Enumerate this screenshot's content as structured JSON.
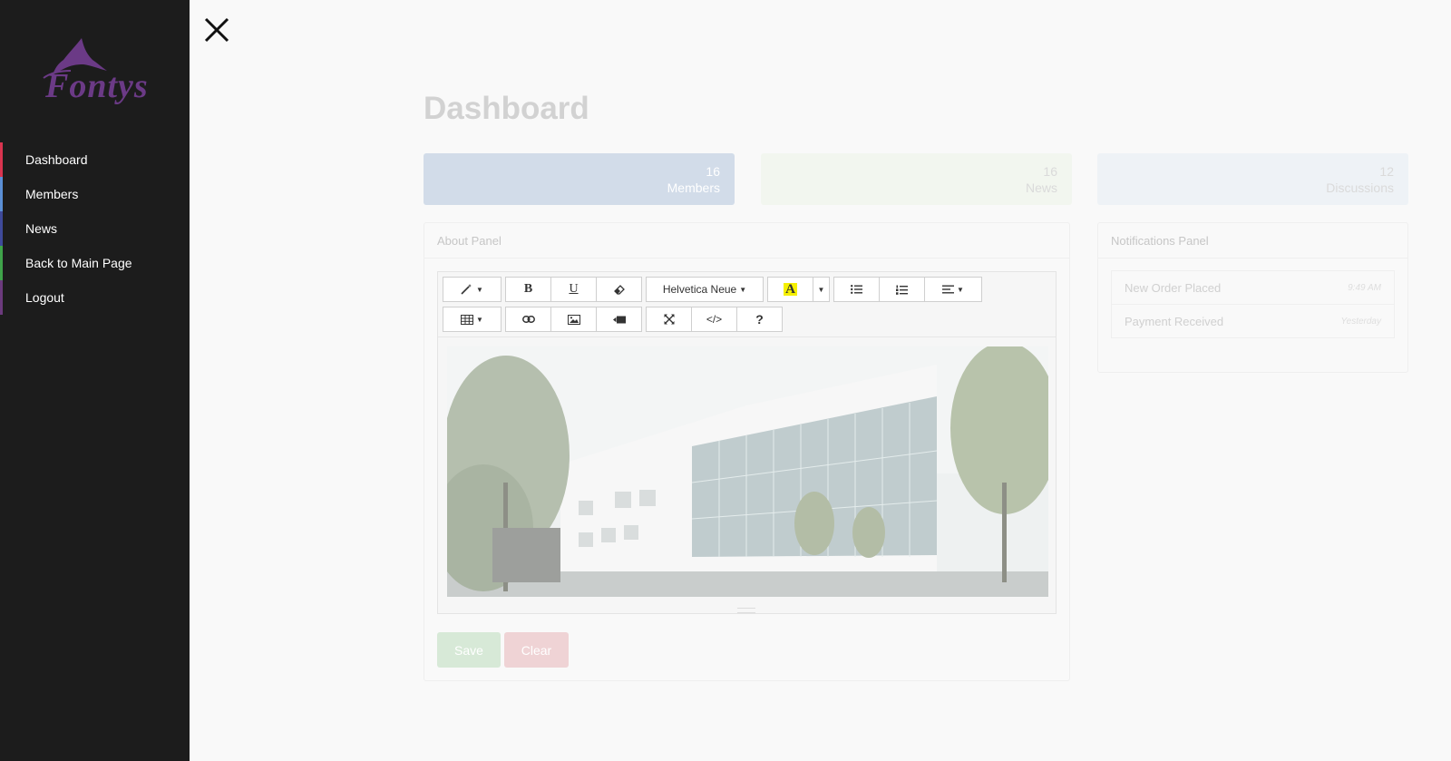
{
  "brand": {
    "logo_text": "Fontys",
    "logo_color": "#6b3a86"
  },
  "sidebar": {
    "items": [
      {
        "label": "Dashboard",
        "accent": "#d9344f"
      },
      {
        "label": "Members",
        "accent": "#5b8fd6"
      },
      {
        "label": "News",
        "accent": "#3f4a9a"
      },
      {
        "label": "Back to Main Page",
        "accent": "#3fa34a"
      },
      {
        "label": "Logout",
        "accent": "#6b3a7d"
      }
    ]
  },
  "main": {
    "title": "Dashboard",
    "stats": [
      {
        "count": "16",
        "label": "Members"
      },
      {
        "count": "16",
        "label": "News"
      },
      {
        "count": "12",
        "label": "Discussions"
      }
    ],
    "about_panel": {
      "title": "About Panel",
      "toolbar": {
        "font_name": "Helvetica Neue",
        "bold": "B",
        "underline": "U",
        "code": "</>",
        "help": "?"
      },
      "save_label": "Save",
      "clear_label": "Clear"
    },
    "notifications_panel": {
      "title": "Notifications Panel",
      "items": [
        {
          "text": "New Order Placed",
          "time": "9:49 AM"
        },
        {
          "text": "Payment Received",
          "time": "Yesterday"
        }
      ]
    }
  }
}
